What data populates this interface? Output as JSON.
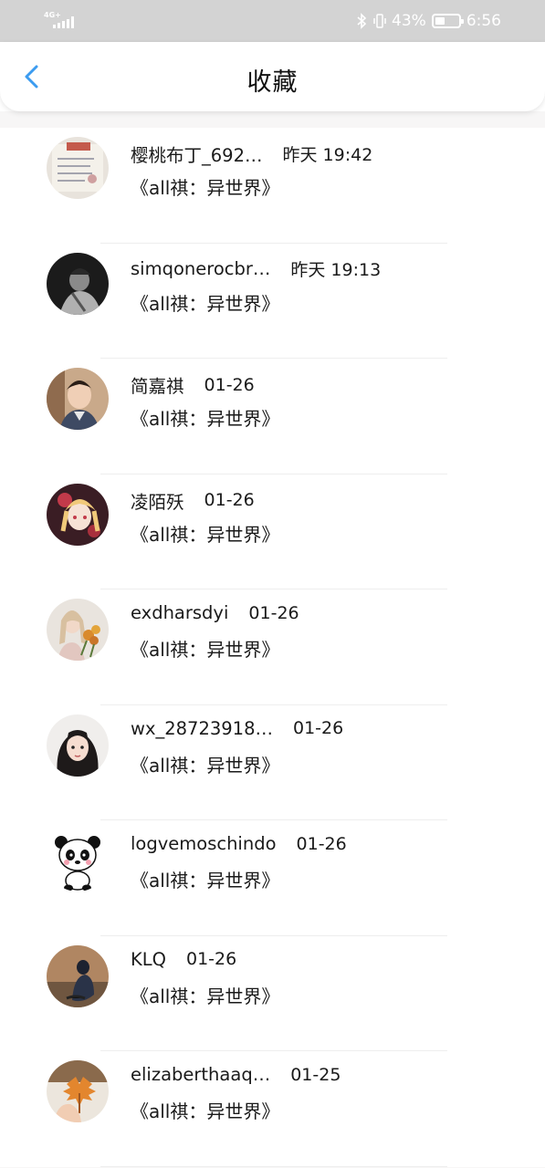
{
  "status_bar": {
    "network": "4G+",
    "battery_percent": "43%",
    "battery_level": 0.43,
    "time": "6:56",
    "icons": [
      "signal-icon",
      "bluetooth-icon",
      "vibrate-icon",
      "battery-icon"
    ]
  },
  "header": {
    "title": "收藏",
    "back_icon": "chevron-left-icon",
    "accent_color": "#3c9cf0"
  },
  "favorites": [
    {
      "username": "樱桃布丁_692…",
      "time": "昨天 19:42",
      "novel": "《all祺：异世界》",
      "avatar": "notebook-photo"
    },
    {
      "username": "simqonerocbr…",
      "time": "昨天 19:13",
      "novel": "《all祺：异世界》",
      "avatar": "bw-person-photo"
    },
    {
      "username": "简嘉祺",
      "time": "01-26",
      "novel": "《all祺：异世界》",
      "avatar": "young-man-photo"
    },
    {
      "username": "凌陌殀",
      "time": "01-26",
      "novel": "《all祺：异世界》",
      "avatar": "anime-girl-drawing"
    },
    {
      "username": "exdharsdyi",
      "time": "01-26",
      "novel": "《all祺：异世界》",
      "avatar": "woman-with-flowers-photo"
    },
    {
      "username": "wx_28723918…",
      "time": "01-26",
      "novel": "《all祺：异世界》",
      "avatar": "girl-portrait-photo"
    },
    {
      "username": "logvemoschindo",
      "time": "01-26",
      "novel": "《all祺：异世界》",
      "avatar": "panda-cartoon"
    },
    {
      "username": "KLQ",
      "time": "01-26",
      "novel": "《all祺：异世界》",
      "avatar": "sitting-figure-photo"
    },
    {
      "username": "elizaberthaaq…",
      "time": "01-25",
      "novel": "《all祺：异世界》",
      "avatar": "hand-with-leaf-photo"
    }
  ]
}
